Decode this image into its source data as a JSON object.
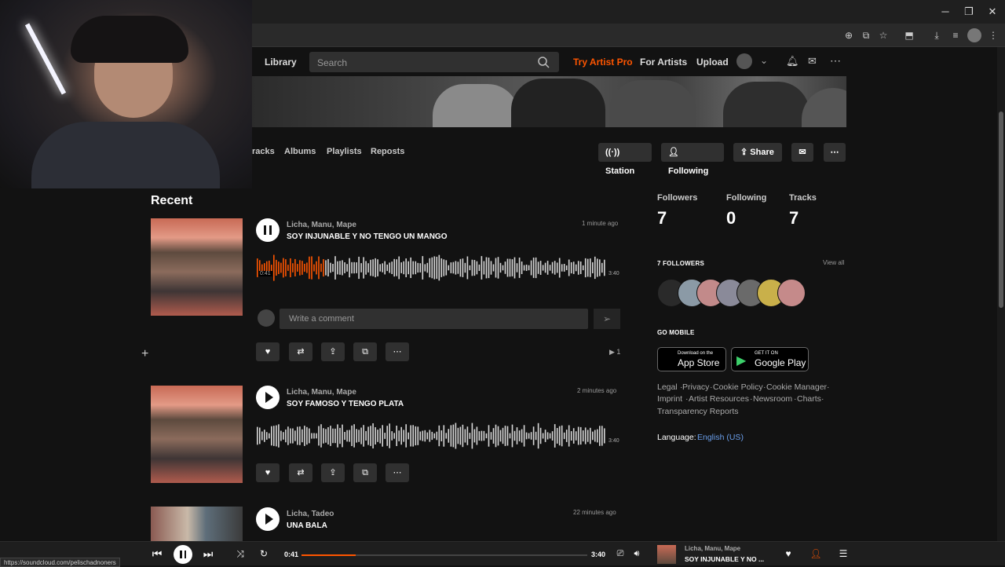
{
  "nav": {
    "library": "Library",
    "search_placeholder": "Search",
    "try_artist_pro": "Try Artist Pro",
    "for_artists": "For Artists",
    "upload": "Upload"
  },
  "tabs": [
    "racks",
    "Albums",
    "Playlists",
    "Reposts"
  ],
  "profile_buttons": {
    "station": "Station",
    "following": "Following",
    "share": "Share"
  },
  "recent_heading": "Recent",
  "tracks": [
    {
      "artist": "Licha, Manu, Mape",
      "title": "SOY INJUNABLE Y NO TENGO UN MANGO",
      "time_ago": "1 minute ago",
      "duration": "3:40",
      "position": "0:41",
      "progress": 0.19,
      "plays": "1"
    },
    {
      "artist": "Licha, Manu, Mape",
      "title": "SOY FAMOSO Y TENGO PLATA",
      "time_ago": "2 minutes ago",
      "duration": "3:40"
    },
    {
      "artist": "Licha, Tadeo",
      "title": "UNA BALA",
      "time_ago": "22 minutes ago"
    }
  ],
  "comment_placeholder": "Write a comment",
  "stats": [
    {
      "label": "Followers",
      "value": "7"
    },
    {
      "label": "Following",
      "value": "0"
    },
    {
      "label": "Tracks",
      "value": "7"
    }
  ],
  "followers_heading": "7 FOLLOWERS",
  "view_all": "View all",
  "go_mobile": "GO MOBILE",
  "app_store": {
    "small": "Download on the",
    "big": "App Store"
  },
  "google_play": {
    "small": "GET IT ON",
    "big": "Google Play"
  },
  "footer_links": [
    "Legal",
    "Privacy",
    "Cookie Policy",
    "Cookie Manager",
    "Imprint",
    "Artist Resources",
    "Newsroom",
    "Charts",
    "Transparency Reports"
  ],
  "language_label": "Language:",
  "language_value": "English (US)",
  "player": {
    "elapsed": "0:41",
    "duration": "3:40",
    "progress": 0.19,
    "artist": "Licha, Manu, Mape",
    "title": "SOY INJUNABLE Y NO ..."
  },
  "status_url": "https://soundcloud.com/pelischadnoners",
  "colors": {
    "accent": "#ff5500",
    "link": "#6a9eea",
    "background": "#121212"
  }
}
